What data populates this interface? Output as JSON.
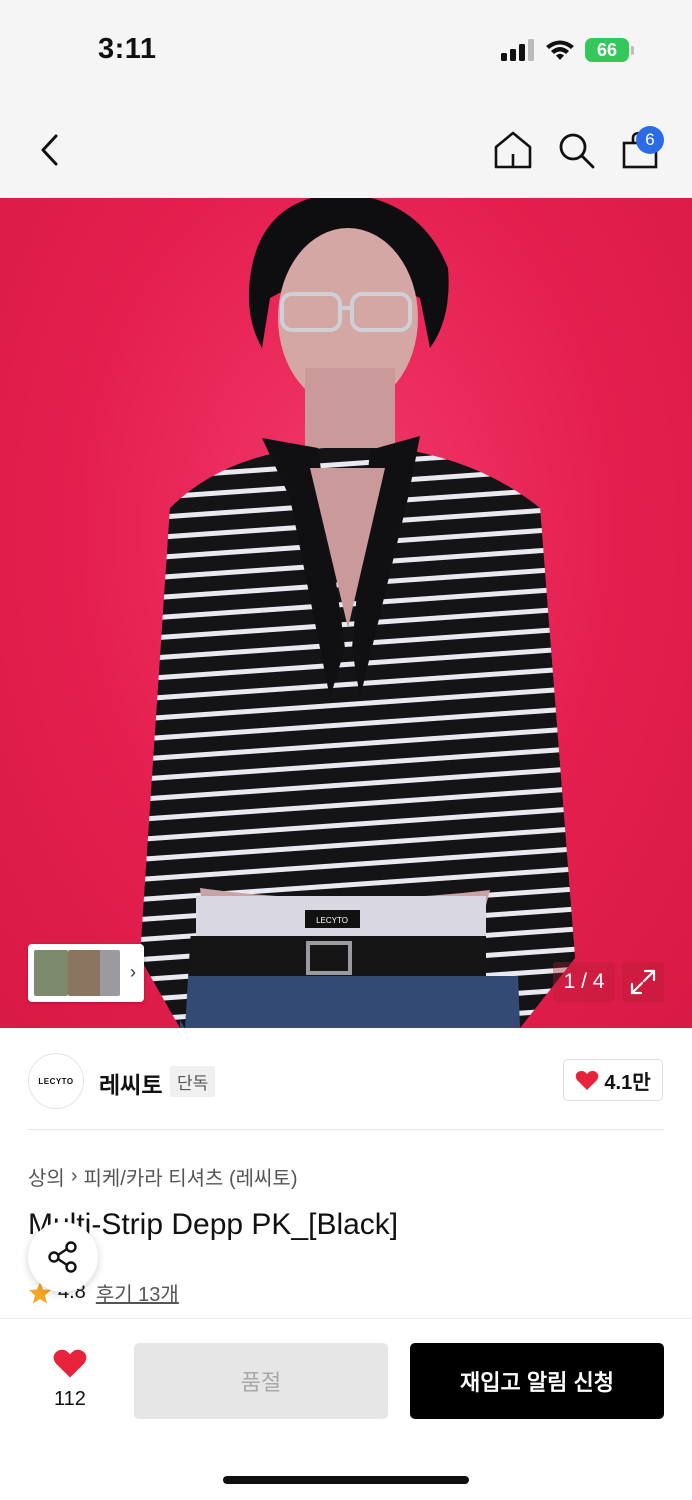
{
  "status_bar": {
    "time": "3:11",
    "battery": "66"
  },
  "nav": {
    "cart_count": "6"
  },
  "gallery": {
    "page_counter": "1 / 4",
    "logo_text": "LECYTO"
  },
  "brand": {
    "logo_text": "LECYTO",
    "name": "레씨토",
    "tag": "단독",
    "likes": "4.1만"
  },
  "breadcrumb": {
    "category": "상의",
    "subcategory": "피케/카라 티셔츠 (레씨토)"
  },
  "product": {
    "title": "Multi-Strip Depp PK_[Black]",
    "rating": "4.8",
    "reviews": "후기 13개"
  },
  "bottom_bar": {
    "wish_count": "112",
    "soldout_label": "품절",
    "restock_label": "재입고 알림 신청"
  },
  "colors": {
    "accent_red": "#e8223a",
    "badge_blue": "#2b6be6",
    "hero_bg": "#e41f4f",
    "battery_green": "#34c759"
  },
  "icons": [
    "back-chevron-icon",
    "home-icon",
    "search-icon",
    "shopping-bag-icon",
    "expand-icon",
    "heart-icon",
    "star-icon",
    "share-icon"
  ]
}
